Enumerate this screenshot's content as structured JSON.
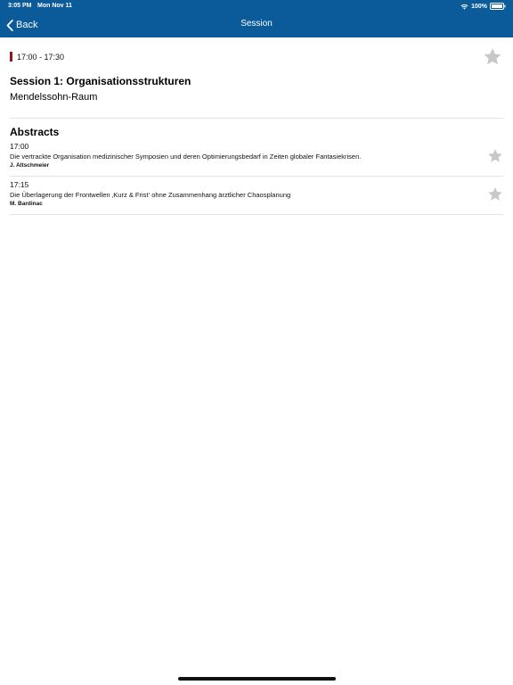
{
  "status_bar": {
    "time": "3:05 PM",
    "date": "Mon Nov 11",
    "battery": "100%"
  },
  "nav": {
    "back_label": "Back",
    "title": "Session"
  },
  "session": {
    "time": "17:00 - 17:30",
    "title": "Session 1: Organisationsstrukturen",
    "room": "Mendelssohn-Raum",
    "favorite": false
  },
  "abstracts": {
    "heading": "Abstracts",
    "items": [
      {
        "time": "17:00",
        "title": "Die vertrackte Organisation medizinischer Symposien und deren Optimierungsbedarf in Zeiten globaler Fantasiekrisen.",
        "author": "J. Altschmeier",
        "favorite": false
      },
      {
        "time": "17:15",
        "title": "Die Überlagerung der Frontwellen ‚Kurz & Frist‘ ohne Zusammenhang ärztlicher Chaosplanung",
        "author": "M. Bardinac",
        "favorite": false
      }
    ]
  },
  "colors": {
    "nav_bar": "#0b5a9a",
    "time_accent": "#8b1a1a",
    "star_inactive": "#c8c8c8"
  }
}
